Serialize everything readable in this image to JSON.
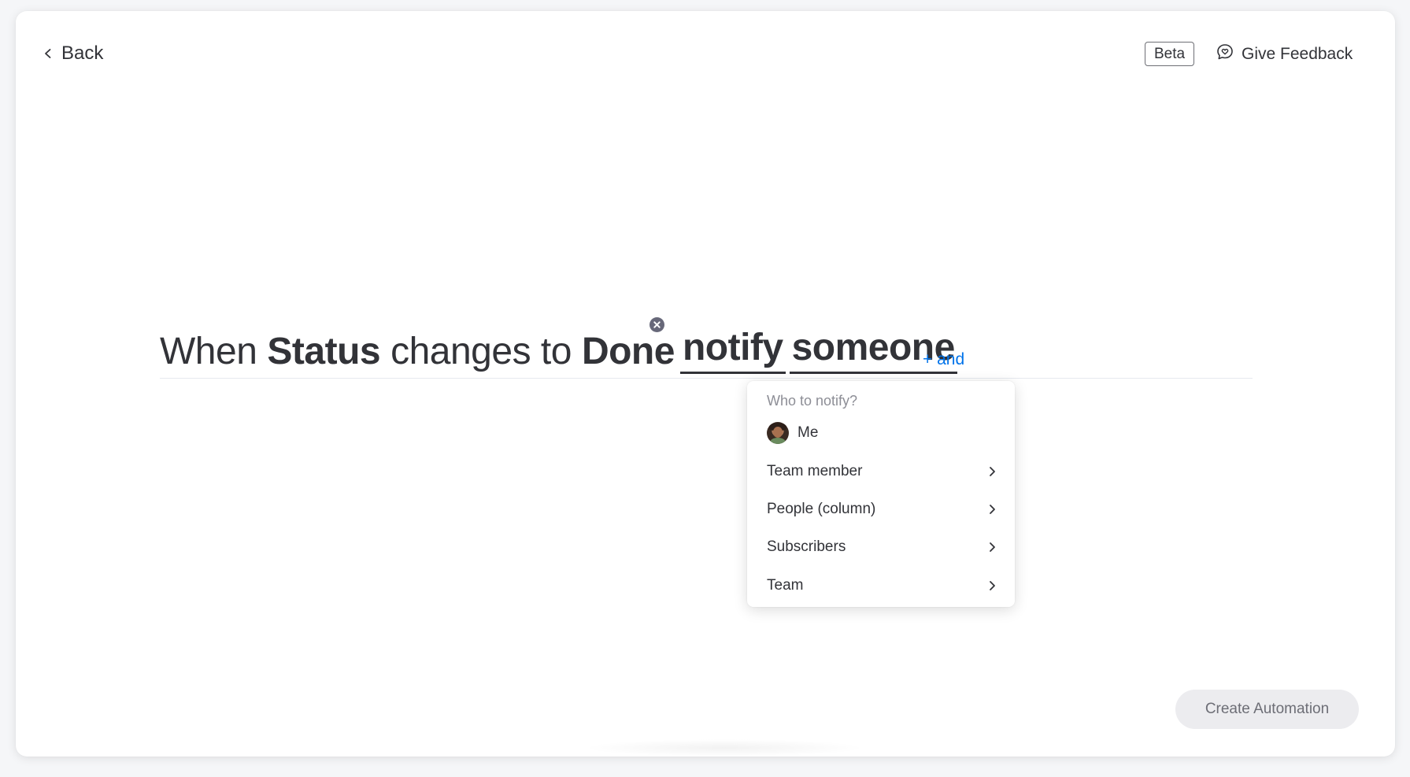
{
  "header": {
    "back_label": "Back",
    "beta_label": "Beta",
    "feedback_label": "Give Feedback"
  },
  "sentence": {
    "when": "When",
    "field": "Status",
    "changes_to": "changes to",
    "value": "Done",
    "action": "notify",
    "target": "someone",
    "add_condition": "+ and"
  },
  "dropdown": {
    "header": "Who to notify?",
    "me_label": "Me",
    "items": [
      {
        "label": "Team member"
      },
      {
        "label": "People (column)"
      },
      {
        "label": "Subscribers"
      },
      {
        "label": "Team"
      }
    ]
  },
  "footer": {
    "create_label": "Create Automation"
  },
  "colors": {
    "text": "#323338",
    "link": "#0073ea",
    "muted": "#8d8e96",
    "button_bg": "#ececef"
  },
  "icons": {
    "back": "chevron-left-icon",
    "feedback": "chat-heart-icon",
    "remove": "close-circle-icon",
    "submenu": "chevron-right-icon"
  }
}
